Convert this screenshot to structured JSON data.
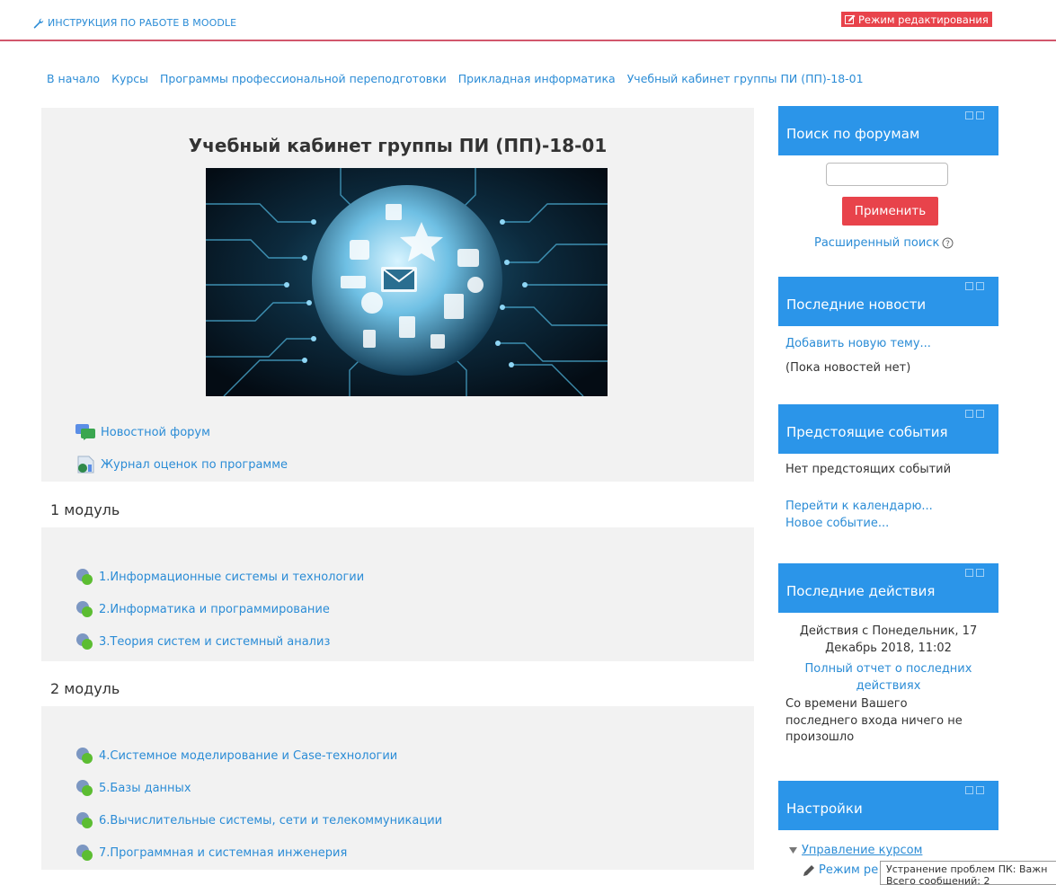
{
  "topbar": {
    "instruction_link": "ИНСТРУКЦИЯ ПО РАБОТЕ В MOODLE",
    "edit_mode_button": "Режим редактирования"
  },
  "breadcrumb": [
    "В начало",
    "Курсы",
    "Программы профессиональной переподготовки",
    "Прикладная информатика",
    "Учебный кабинет группы ПИ (ПП)-18-01"
  ],
  "course": {
    "title": "Учебный кабинет группы ПИ (ПП)-18-01",
    "news_forum": "Новостной форум",
    "grades_journal": "Журнал оценок по программе"
  },
  "sections": [
    {
      "title": "1 модуль",
      "items": [
        "1.Информационные системы и технологии",
        "2.Информатика и программирование",
        "3.Теория систем и системный анализ"
      ]
    },
    {
      "title": "2 модуль",
      "items": [
        "4.Системное моделирование и Case-технологии",
        "5.Базы данных",
        "6.Вычислительные системы, сети и телекоммуникации",
        "7.Программная и системная инженерия"
      ]
    }
  ],
  "blocks": {
    "forum_search": {
      "title": "Поиск по форумам",
      "apply_button": "Применить",
      "advanced_search": "Расширенный поиск"
    },
    "latest_news": {
      "title": "Последние новости",
      "add_topic": "Добавить новую тему...",
      "no_news": "(Пока новостей нет)"
    },
    "upcoming_events": {
      "title": "Предстоящие события",
      "no_events": "Нет предстоящих событий",
      "calendar_link": "Перейти к календарю...",
      "new_event": "Новое событие..."
    },
    "recent_activity": {
      "title": "Последние действия",
      "since_line1": "Действия с Понедельник, 17",
      "since_line2": "Декабрь 2018, 11:02",
      "full_report_line1": "Полный отчет о последних",
      "full_report_line2": "действиях",
      "nothing_line1": "Со времени Вашего",
      "nothing_line2": "последнего входа ничего не",
      "nothing_line3": "произошло"
    },
    "settings": {
      "title": "Настройки",
      "course_admin": "Управление курсом",
      "edit_mode": "Режим ре"
    }
  },
  "tooltip": {
    "line1": "Устранение проблем ПК: Важн",
    "line2": "Всего сообщений: 2"
  },
  "colors": {
    "accent_blue": "#2b95e9",
    "link": "#2b8cd6",
    "danger": "#e8434b",
    "panel": "#f2f2f2",
    "topbar_border": "#d2576c"
  }
}
